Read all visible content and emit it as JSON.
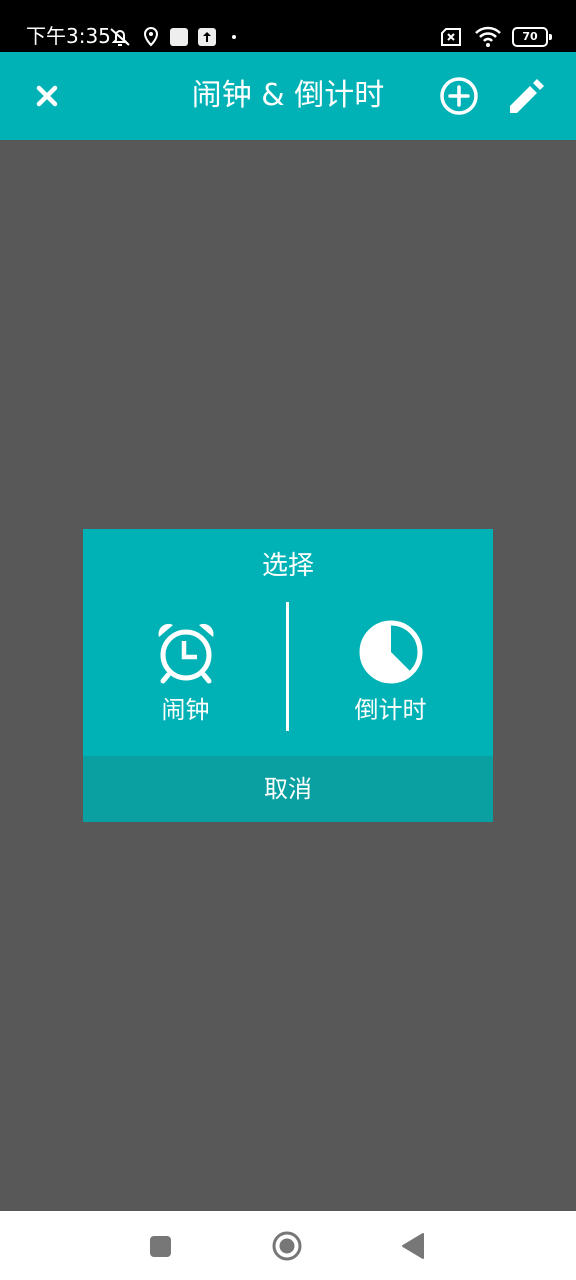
{
  "status_bar": {
    "time": "下午3:35",
    "battery": "70",
    "icons": [
      "mute-bell-icon",
      "location-icon",
      "app-square-icon",
      "upload-icon",
      "dot-icon",
      "sim-x-icon",
      "wifi-icon",
      "battery-icon"
    ]
  },
  "app_bar": {
    "title": "闹钟 & 倒计时",
    "close_icon": "close-icon",
    "add_icon": "add-circle-icon",
    "edit_icon": "pencil-icon",
    "color": "#00b2b5"
  },
  "dialog": {
    "title": "选择",
    "options": [
      {
        "label": "闹钟",
        "icon": "alarm-clock-icon"
      },
      {
        "label": "倒计时",
        "icon": "pie-timer-icon"
      }
    ],
    "cancel_label": "取消",
    "background": "#00b2b5",
    "cancel_background": "#0aa0a1"
  },
  "overlay_color": "#585858",
  "nav_bar": {
    "buttons": [
      "recent-apps-icon",
      "home-icon",
      "back-icon"
    ]
  }
}
